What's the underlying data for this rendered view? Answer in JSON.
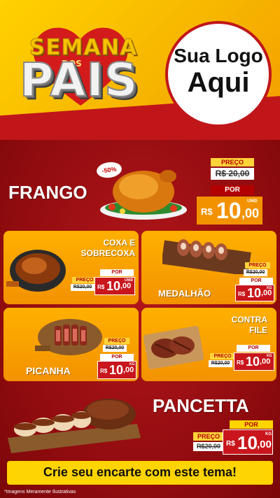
{
  "header": {
    "campaign_word1": "SEMANA",
    "campaign_word2": "DOS",
    "campaign_word3": "PAIS",
    "logo_line1": "Sua Logo",
    "logo_line2": "Aqui"
  },
  "featured": {
    "name": "FRANGO",
    "discount": "-50%",
    "preco_label": "PREÇO",
    "old_price": "R$ 20,00",
    "por_label": "POR",
    "currency": "R$",
    "price_int": "10",
    "price_dec": ",00",
    "unit": "UNID"
  },
  "products": [
    {
      "name_line1": "COXA E",
      "name_line2": "SOBRECOXA",
      "preco_label": "PREÇO",
      "old_price": "R$20,00",
      "por_label": "POR",
      "currency": "R$",
      "price_int": "10",
      "price_dec": ",00",
      "unit": "UNID"
    },
    {
      "name_line1": "MEDALHÃO",
      "preco_label": "PREÇO",
      "old_price": "R$20,00",
      "por_label": "POR",
      "currency": "R$",
      "price_int": "10",
      "price_dec": ",00",
      "unit": "KG"
    },
    {
      "name_line1": "PICANHA",
      "preco_label": "PREÇO",
      "old_price": "R$20,00",
      "por_label": "POR",
      "currency": "R$",
      "price_int": "10",
      "price_dec": ",00",
      "unit": "KG"
    },
    {
      "name_line1": "CONTRA",
      "name_line2": "FILE",
      "preco_label": "PREÇO",
      "old_price": "R$20,00",
      "por_label": "POR",
      "currency": "R$",
      "price_int": "10",
      "price_dec": ",00",
      "unit": "KG"
    }
  ],
  "bottom": {
    "name": "PANCETTA",
    "preco_label": "PREÇO",
    "old_price": "R$20,00",
    "por_label": "POR",
    "currency": "R$",
    "price_int": "10",
    "price_dec": ",00",
    "unit": "KG"
  },
  "footer": {
    "cta": "Crie seu encarte com este tema!",
    "disclaimer": "*Imagens Meramente Ilustrativas"
  },
  "colors": {
    "red": "#b30000",
    "yellow": "#ffd400",
    "orange": "#f39200"
  }
}
